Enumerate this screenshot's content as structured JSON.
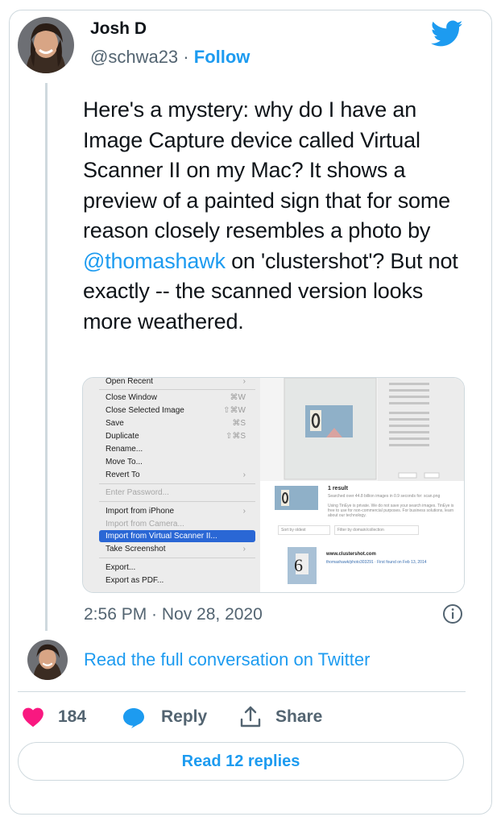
{
  "author": {
    "name": "Josh D",
    "handle": "@schwa23",
    "separator": "·",
    "follow_label": "Follow"
  },
  "tweet": {
    "text_before": "Here's a mystery: why do I have an Image Capture device called Virtual Scanner II on my Mac? It shows a preview of a painted sign that for some reason closely resembles a photo by ",
    "mention": "@thomashawk",
    "text_after": " on 'clustershot'? But not exactly -- the scanned version looks more weathered."
  },
  "media": {
    "menu_items": [
      {
        "label": "Open Recent",
        "shortcut": "›"
      },
      {
        "label": "Close Window",
        "shortcut": "⌘W"
      },
      {
        "label": "Close Selected Image",
        "shortcut": "⇧⌘W"
      },
      {
        "label": "Save",
        "shortcut": "⌘S"
      },
      {
        "label": "Duplicate",
        "shortcut": "⇧⌘S"
      },
      {
        "label": "Rename...",
        "shortcut": ""
      },
      {
        "label": "Move To...",
        "shortcut": ""
      },
      {
        "label": "Revert To",
        "shortcut": "›"
      },
      {
        "label": "Enter Password...",
        "shortcut": ""
      },
      {
        "label": "Import from iPhone",
        "shortcut": "›"
      },
      {
        "label": "Import from Camera...",
        "shortcut": ""
      },
      {
        "label": "Import from Virtual Scanner II...",
        "shortcut": ""
      },
      {
        "label": "Take Screenshot",
        "shortcut": "›"
      },
      {
        "label": "Export...",
        "shortcut": ""
      },
      {
        "label": "Export as PDF...",
        "shortcut": ""
      }
    ],
    "result_title": "1 result",
    "result_sub": "Searched over 44.8 billion images in 0.9 seconds for: scan.png",
    "result_note": "Using TinEye is private. We do not save your search images. TinEye is free to use for non-commercial purposes. For business solutions, learn about our technology.",
    "sort_label": "Sort by oldest",
    "filter_placeholder": "Filter by domain/collection",
    "match_domain": "www.clustershot.com",
    "match_path": "thomashawk/photo303291 · First found on Feb 13, 2014",
    "sign_number": "6"
  },
  "timestamp": "2:56 PM · Nov 28, 2020",
  "read_conversation": "Read the full conversation on Twitter",
  "actions": {
    "like_count": "184",
    "reply_label": "Reply",
    "share_label": "Share"
  },
  "read_replies": "Read 12 replies",
  "colors": {
    "accent": "#1d9bf0",
    "like": "#f91880",
    "muted": "#536471"
  }
}
